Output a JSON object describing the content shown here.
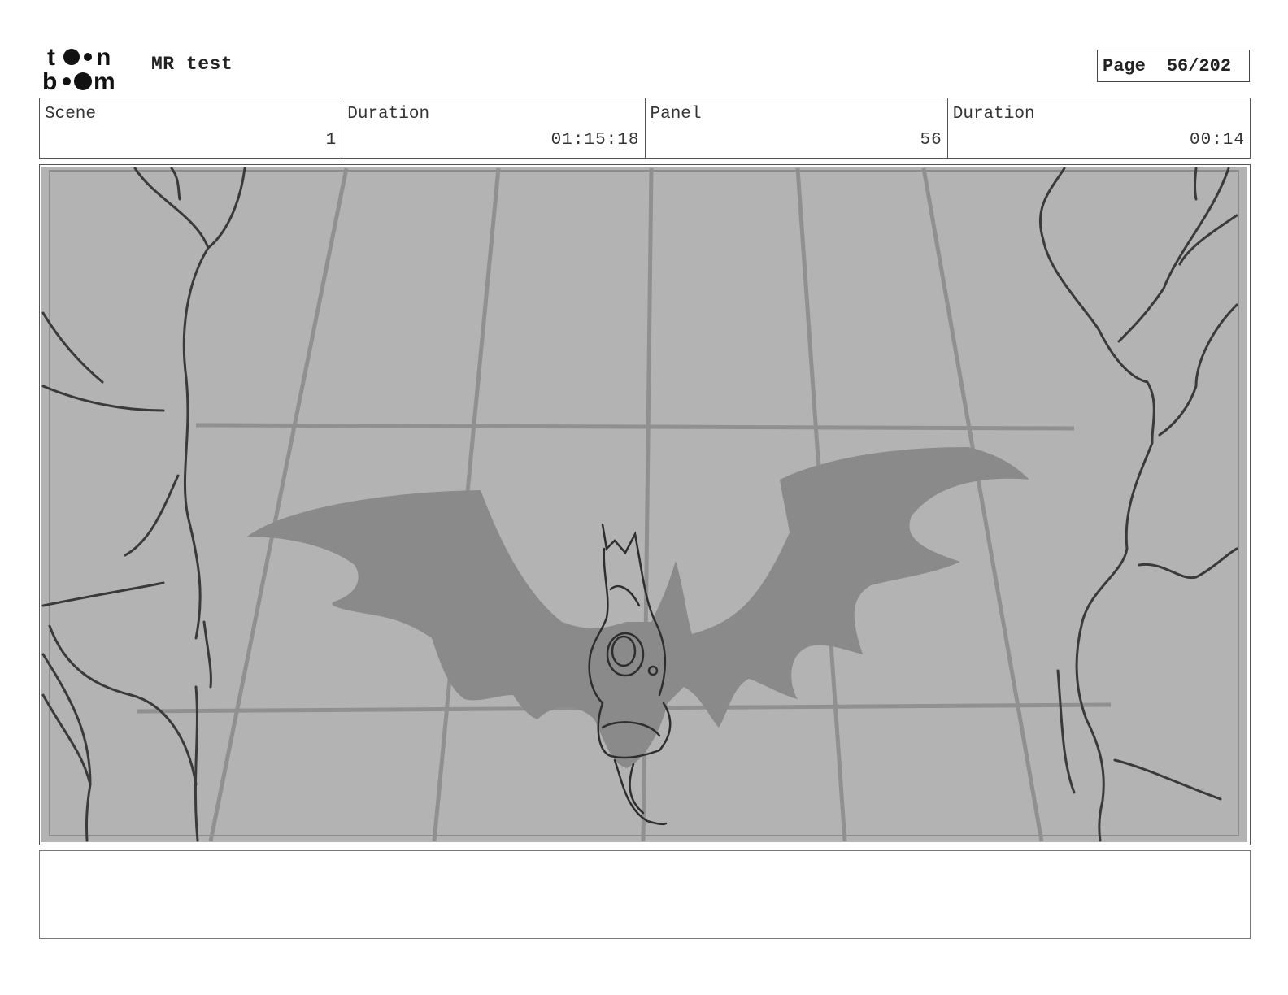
{
  "header": {
    "logo_text": "toon boom",
    "project_title": "MR test",
    "page_label": "Page",
    "page_value": "56/202"
  },
  "info": {
    "scene_label": "Scene",
    "scene_value": "1",
    "scene_duration_label": "Duration",
    "scene_duration_value": "01:15:18",
    "panel_label": "Panel",
    "panel_value": "56",
    "panel_duration_label": "Duration",
    "panel_duration_value": "00:14"
  },
  "notes": {
    "text": ""
  },
  "colors": {
    "panel_background": "#b3b3b3",
    "wing_shadow": "#8a8a8a",
    "grid_lines": "#909090",
    "sketch_lines": "#3a3a3a"
  }
}
